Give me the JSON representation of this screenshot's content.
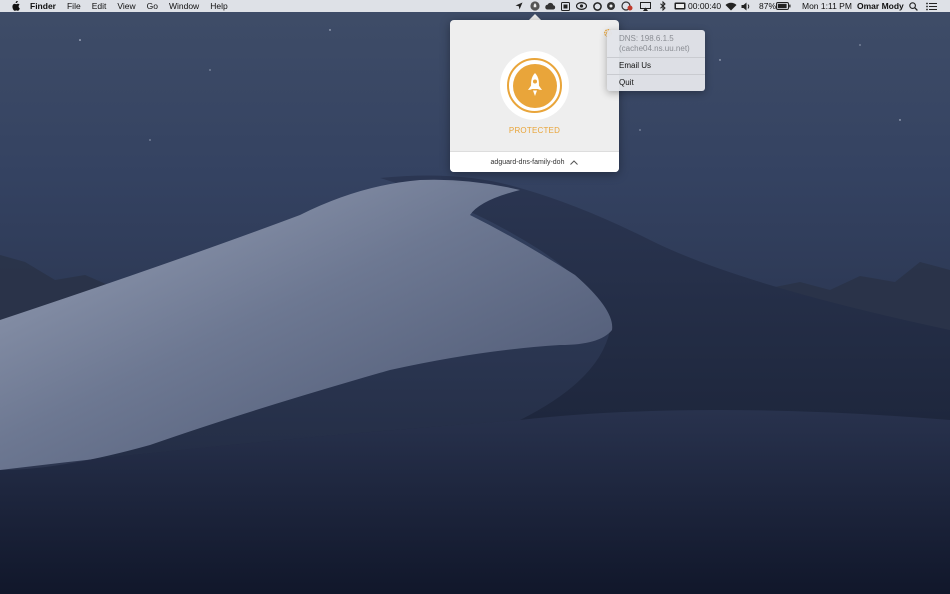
{
  "menubar": {
    "apple_icon": "apple-logo",
    "app_name": "Finder",
    "menus": [
      "File",
      "Edit",
      "View",
      "Go",
      "Window",
      "Help"
    ],
    "status_icons": [
      "location-arrow-icon",
      "adguard-icon",
      "cloud-icon",
      "stamp-icon",
      "eye-icon",
      "ring-icon",
      "gear-badge-icon",
      "privacy-icon",
      "airplay-icon",
      "bluetooth-icon"
    ],
    "timer_icon": "timer-icon",
    "timer": "00:00:40",
    "wifi_icon": "wifi-icon",
    "volume_icon": "volume-icon",
    "battery_percent": "87%",
    "battery_icon": "battery-icon",
    "clock": "Mon 1:11 PM",
    "user": "Omar Mody",
    "search_icon": "spotlight-search-icon",
    "list_icon": "notification-center-icon"
  },
  "popover": {
    "gear_icon": "gear-icon",
    "shield_icon": "rocket-icon",
    "status": "PROTECTED",
    "server": "adguard-dns-family-doh",
    "chevron_icon": "chevron-up-icon"
  },
  "dropdown": {
    "dns_line1": "DNS: 198.6.1.5",
    "dns_line2": "(cache04.ns.uu.net)",
    "email": "Email Us",
    "quit": "Quit"
  },
  "colors": {
    "accent": "#e9a53a",
    "menubar": "#eceef2",
    "popover_bg": "#eeeeee"
  }
}
